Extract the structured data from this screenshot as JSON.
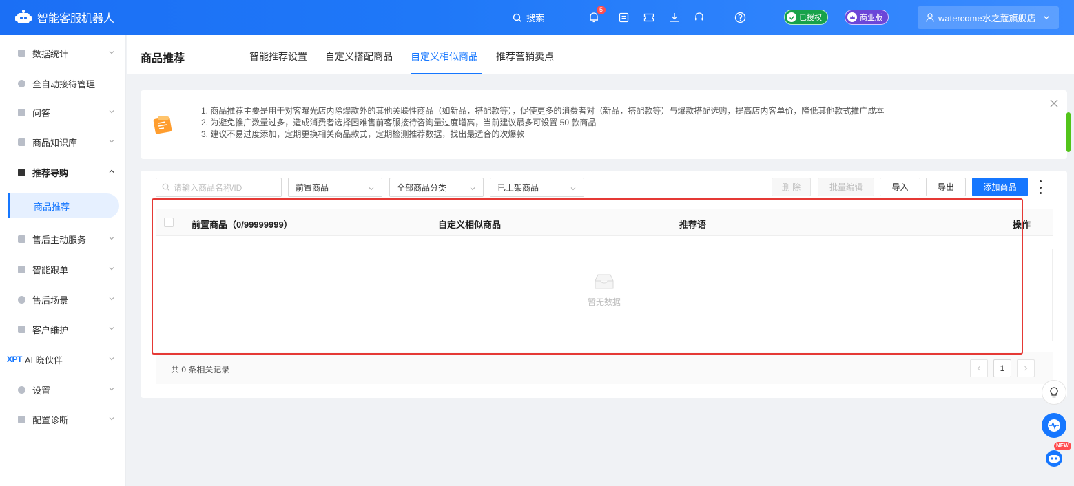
{
  "app": {
    "title": "智能客服机器人"
  },
  "topbar": {
    "search_label": "搜索",
    "bell_count": "5",
    "authorized_label": "已授权",
    "edition_label": "商业版",
    "user_name": "watercome水之蔻旗舰店"
  },
  "sidebar": {
    "items": [
      {
        "label": "数据统计"
      },
      {
        "label": "全自动接待管理"
      },
      {
        "label": "问答"
      },
      {
        "label": "商品知识库"
      },
      {
        "label": "推荐导购"
      },
      {
        "label": "商品推荐"
      },
      {
        "label": "售后主动服务"
      },
      {
        "label": "智能跟单"
      },
      {
        "label": "售后场景"
      },
      {
        "label": "客户维护"
      },
      {
        "label": "AI 晓伙伴",
        "prefix": "XPT"
      },
      {
        "label": "设置"
      },
      {
        "label": "配置诊断"
      }
    ]
  },
  "header": {
    "title": "商品推荐",
    "tabs": [
      {
        "label": "智能推荐设置"
      },
      {
        "label": "自定义搭配商品"
      },
      {
        "label": "自定义相似商品",
        "active": true
      },
      {
        "label": "推荐营销卖点"
      }
    ]
  },
  "notice": {
    "lines": [
      "1. 商品推荐主要是用于对客曝光店内除爆款外的其他关联性商品（如新品，搭配款等），促使更多的消费者对（新品，搭配款等）与爆款搭配选购，提高店内客单价，降低其他款式推广成本",
      "2. 为避免推广数量过多，造成消费者选择困难售前客服接待咨询量过度增高，当前建议最多可设置 50 款商品",
      "3. 建议不易过度添加，定期更换相关商品款式，定期检测推荐数据，找出最适合的次爆款"
    ]
  },
  "filters": {
    "search_placeholder": "请输入商品名称/ID",
    "select1": "前置商品",
    "select2": "全部商品分类",
    "select3": "已上架商品"
  },
  "actions": {
    "delete": "删 除",
    "batch_edit": "批量编辑",
    "import": "导入",
    "export": "导出",
    "add": "添加商品"
  },
  "table": {
    "columns": [
      "前置商品（0/99999999）",
      "自定义相似商品",
      "推荐语",
      "操作"
    ],
    "empty_text": "暂无数据"
  },
  "footer": {
    "total": "共 0 条相关记录",
    "page": "1"
  },
  "floating": {
    "new_badge": "NEW"
  },
  "colors": {
    "primary": "#1677ff",
    "highlight": "#e53935",
    "auth": "#17a24a",
    "edition": "#6b46d8"
  }
}
